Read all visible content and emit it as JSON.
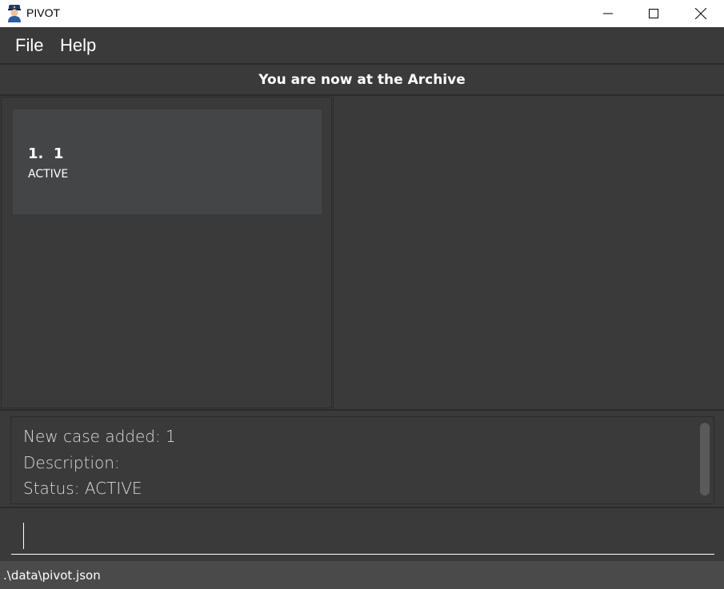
{
  "window": {
    "title": "PIVOT",
    "app_icon": "police-officer-icon",
    "controls": [
      "minimize-icon",
      "maximize-icon",
      "close-icon"
    ]
  },
  "menu": {
    "items": [
      "File",
      "Help"
    ]
  },
  "header": {
    "text": "You are now at the Archive"
  },
  "case_list": {
    "items": [
      {
        "title": "1.  1",
        "status": "ACTIVE"
      }
    ]
  },
  "result": {
    "lines": [
      "New case added: 1",
      "Description:",
      "Status: ACTIVE"
    ]
  },
  "command": {
    "value": ""
  },
  "status_bar": {
    "path": ".\\data\\pivot.json"
  },
  "colors": {
    "background": "#3a3a3a",
    "card": "#434546",
    "status_bar": "#4a4a4a",
    "text": "#ffffff"
  }
}
